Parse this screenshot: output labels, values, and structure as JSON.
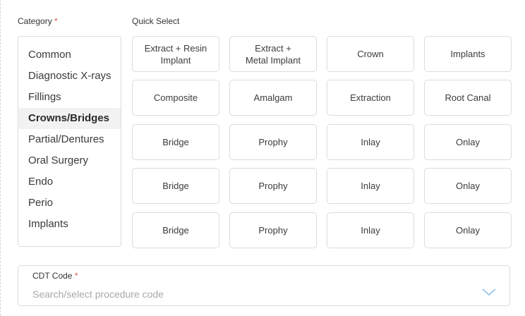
{
  "category": {
    "label": "Category",
    "required_mark": "*",
    "items": [
      {
        "label": "Common"
      },
      {
        "label": "Diagnostic X-rays"
      },
      {
        "label": "Fillings"
      },
      {
        "label": "Crowns/Bridges"
      },
      {
        "label": "Partial/Dentures"
      },
      {
        "label": "Oral Surgery"
      },
      {
        "label": "Endo"
      },
      {
        "label": "Perio"
      },
      {
        "label": "Implants"
      }
    ],
    "selected": "Crowns/Bridges"
  },
  "quick_select": {
    "label": "Quick Select",
    "rows": [
      [
        "Extract + Resin\nImplant",
        "Extract +\nMetal Implant",
        "Crown",
        "Implants"
      ],
      [
        "Composite",
        "Amalgam",
        "Extraction",
        "Root Canal"
      ],
      [
        "Bridge",
        "Prophy",
        "Inlay",
        "Onlay"
      ],
      [
        "Bridge",
        "Prophy",
        "Inlay",
        "Onlay"
      ],
      [
        "Bridge",
        "Prophy",
        "Inlay",
        "Onlay"
      ]
    ]
  },
  "cdt_code": {
    "label": "CDT Code",
    "required_mark": "*",
    "placeholder": "Search/select procedure code",
    "value": ""
  },
  "colors": {
    "accent": "#8fc2e8",
    "required": "#e0524f",
    "border": "#dcdcdc",
    "active_bg": "#f2f2f2"
  },
  "icons": {
    "dropdown": "chevron-down-icon"
  }
}
